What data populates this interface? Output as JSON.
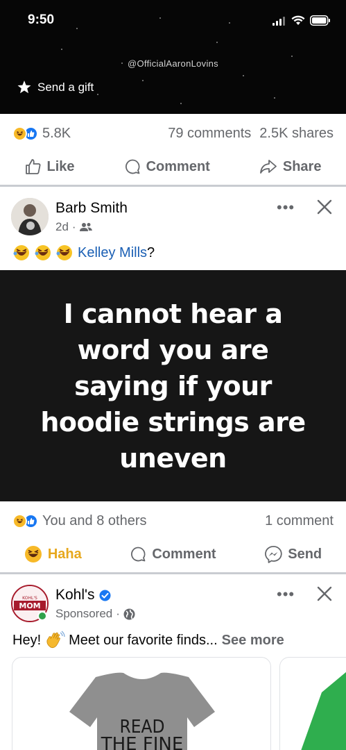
{
  "status_bar": {
    "time": "9:50"
  },
  "video": {
    "watermark": "@OfficialAaronLovins",
    "gift_label": "Send a gift"
  },
  "post1": {
    "reaction_count": "5.8K",
    "comments": "79 comments",
    "shares": "2.5K shares",
    "actions": {
      "like": "Like",
      "comment": "Comment",
      "share": "Share"
    }
  },
  "post2": {
    "author": "Barb Smith",
    "time": "2d",
    "text_suffix": "?",
    "mention": "Kelley Mills",
    "meme_text": "I cannot hear a word you are saying if your hoodie strings are uneven",
    "reactions_text": "You and 8 others",
    "comments": "1 comment",
    "actions": {
      "haha": "Haha",
      "comment": "Comment",
      "send": "Send"
    }
  },
  "post3": {
    "author": "Kohl's",
    "sponsored": "Sponsored",
    "avatar_text": "MOM",
    "avatar_small": "KOHL'S",
    "text_start": "Hey!",
    "text_rest": "Meet our favorite finds...",
    "see_more": "See more",
    "shirt_text": "READ THE FINE"
  },
  "colors": {
    "accent_blue": "#1877f2",
    "haha_yellow": "#f7b928",
    "muted_gray": "#65676b",
    "divider": "#c9ccd1",
    "online_green": "#31a24c"
  }
}
